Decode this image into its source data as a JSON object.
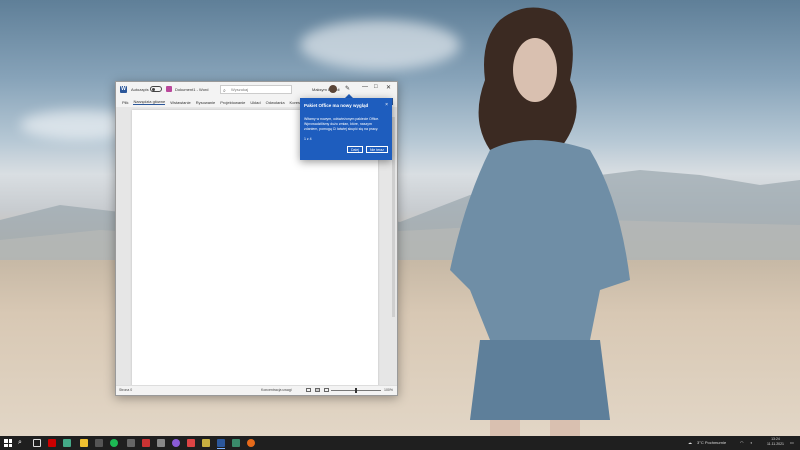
{
  "word": {
    "autosave_label": "Autozapis",
    "doc_name": "Dokument1 - Word",
    "search_placeholder": "Wyszukaj",
    "user_name": "Maksym Borodi",
    "ribbon_tabs": [
      "Plik",
      "Narzędzia główne",
      "Wstawianie",
      "Rysowanie",
      "Projektowanie",
      "Układ",
      "Odwołania",
      "Korespondencja"
    ],
    "status_page": "Strona 0",
    "status_focus": "Koncentracja uwagi",
    "zoom_percent": "100%"
  },
  "popup": {
    "title": "Pakiet Office ma nowy wygląd",
    "body": "Witamy w nowym, odświeżonym pakiecie Office. Wprowadziliśmy dużo zmian, które, naszym zdaniem, pomogą Ci łatwiej skupić się na pracy.",
    "step": "1 z 4",
    "next_label": "Dalej",
    "close_label": "Nie teraz"
  },
  "taskbar": {
    "weather": "3°C  Pochmurnie",
    "time": "13:24",
    "date": "11.11.2021"
  },
  "colors": {
    "word_blue": "#2b579a",
    "popup_blue": "#1e5dbe",
    "taskbar": "#1f1f1f"
  }
}
